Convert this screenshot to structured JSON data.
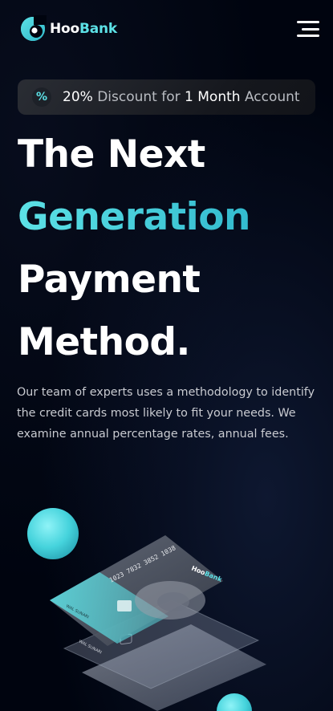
{
  "navbar": {
    "logo_part1": "Hoo",
    "logo_part2": "Bank"
  },
  "discount": {
    "icon_symbol": "%",
    "percent": "20%",
    "word_discount": "Discount for",
    "duration": "1 Month",
    "word_account": "Account"
  },
  "hero": {
    "line1": "The Next",
    "line2": "Generation",
    "line3": "Payment",
    "line4": "Method.",
    "description": "Our team of experts uses a methodology to identify the credit cards most likely to fit your needs. We examine annual percentage rates, annual fees."
  },
  "card": {
    "number": "1023 7832 3852 1038",
    "brand_part1": "Hoo",
    "brand_part2": "Bank",
    "holder_top": "WAL SUNARI",
    "holder_bottom": "WAL SUNARI"
  },
  "colors": {
    "background": "#00040f",
    "accent": "#5ce1e6",
    "text_dim": "#b9bcc2"
  },
  "icons": [
    "hoobank-logo-icon",
    "hamburger-menu-icon",
    "discount-percent-icon",
    "chip-icon",
    "contactless-icon"
  ]
}
